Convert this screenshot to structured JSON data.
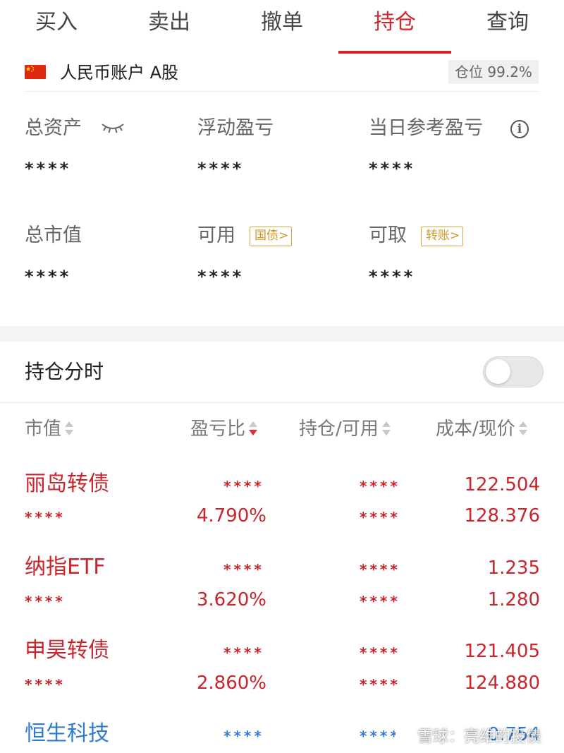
{
  "tabs": [
    {
      "label": "买入",
      "active": false
    },
    {
      "label": "卖出",
      "active": false
    },
    {
      "label": "撤单",
      "active": false
    },
    {
      "label": "持仓",
      "active": true
    },
    {
      "label": "查询",
      "active": false
    }
  ],
  "account": {
    "name": "人民币账户 A股",
    "position_ratio": "仓位 99.2%"
  },
  "summary": {
    "total_assets": {
      "label": "总资产",
      "value": "****"
    },
    "floating_pnl": {
      "label": "浮动盈亏",
      "value": "****"
    },
    "daily_pnl": {
      "label": "当日参考盈亏",
      "value": "****"
    },
    "market_value": {
      "label": "总市值",
      "value": "****"
    },
    "available": {
      "label": "可用",
      "value": "****",
      "tag": "国债>"
    },
    "withdrawable": {
      "label": "可取",
      "value": "****",
      "tag": "转账>"
    }
  },
  "timeshare": {
    "label": "持仓分时",
    "enabled": false
  },
  "columns": [
    "市值",
    "盈亏比",
    "持仓/可用",
    "成本/现价"
  ],
  "holdings": [
    {
      "name": "丽岛转债",
      "market_value": "****",
      "pnl": "****",
      "pnl_ratio": "4.790%",
      "position": "****",
      "available": "****",
      "cost": "122.504",
      "price": "128.376",
      "color": "#c9252d"
    },
    {
      "name": "纳指ETF",
      "market_value": "****",
      "pnl": "****",
      "pnl_ratio": "3.620%",
      "position": "****",
      "available": "****",
      "cost": "1.235",
      "price": "1.280",
      "color": "#c9252d"
    },
    {
      "name": "申昊转债",
      "market_value": "****",
      "pnl": "****",
      "pnl_ratio": "2.860%",
      "position": "****",
      "available": "****",
      "cost": "121.405",
      "price": "124.880",
      "color": "#c9252d"
    },
    {
      "name": "恒生科技",
      "market_value": "",
      "pnl": "****",
      "pnl_ratio": "",
      "position": "****",
      "available": "",
      "cost": "0.754",
      "price": "",
      "color": "#2d7bd2"
    }
  ],
  "watermark": "雪球：亮维的投债"
}
